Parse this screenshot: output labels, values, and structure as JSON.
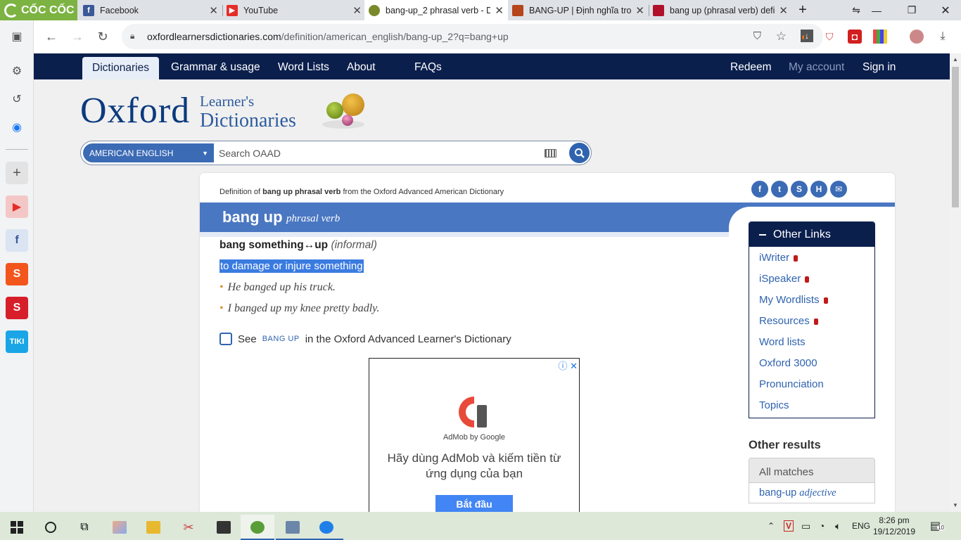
{
  "browser": {
    "brand": "CỐC CỐC",
    "tabs": [
      {
        "title": "Facebook",
        "icon": "facebook-icon",
        "color": "#3b5998"
      },
      {
        "title": "YouTube",
        "icon": "youtube-icon",
        "color": "#e52d27"
      },
      {
        "title": "bang-up_2 phrasal verb - D",
        "icon": "oxford-icon",
        "color": "#7a8a2a",
        "active": true
      },
      {
        "title": "BANG-UP | Định nghĩa tron",
        "icon": "cambridge-icon",
        "color": "#b5451b"
      },
      {
        "title": "bang up (phrasal verb) defi",
        "icon": "book-icon",
        "color": "#b0102a"
      }
    ],
    "new_tab": "+",
    "url_domain": "oxfordlearnersdictionaries.com",
    "url_path": "/definition/american_english/bang-up_2?q=bang+up"
  },
  "nav": {
    "items": [
      "Dictionaries",
      "Grammar & usage",
      "Word Lists",
      "About",
      "FAQs"
    ],
    "right": [
      "Redeem",
      "My account",
      "Sign in"
    ]
  },
  "logo": {
    "oxford": "Oxford",
    "line1": "Learner's",
    "line2": "Dictionaries"
  },
  "search": {
    "dictionary": "AMERICAN ENGLISH",
    "placeholder": "Search OAAD"
  },
  "entry": {
    "crumb_prefix": "Definition of",
    "crumb_term": "bang up phrasal verb",
    "crumb_suffix": "from the Oxford Advanced American Dictionary",
    "headword": "bang up",
    "pos": "phrasal verb",
    "idiom_main": "bang something↔up",
    "idiom_label": "(informal)",
    "definition": "to damage or injure something",
    "examples": [
      "He banged up his truck.",
      "I banged up my knee pretty badly."
    ],
    "see_prefix": "See",
    "see_term": "BANG UP",
    "see_suffix": "in the Oxford Advanced Learner's Dictionary"
  },
  "ad": {
    "brand": "AdMob by Google",
    "message": "Hãy dùng AdMob và kiếm tiền từ ứng dụng của bạn",
    "cta": "Bắt đầu"
  },
  "other_links": {
    "title": "Other Links",
    "items": [
      {
        "label": "iWriter",
        "locked": true
      },
      {
        "label": "iSpeaker",
        "locked": true
      },
      {
        "label": "My Wordlists",
        "locked": true
      },
      {
        "label": "Resources",
        "locked": true
      },
      {
        "label": "Word lists",
        "locked": false
      },
      {
        "label": "Oxford 3000",
        "locked": false
      },
      {
        "label": "Pronunciation",
        "locked": false
      },
      {
        "label": "Topics",
        "locked": false
      }
    ]
  },
  "other_results": {
    "title": "Other results",
    "all_matches": "All matches",
    "result_word": "bang-up",
    "result_pos": "adjective"
  },
  "taskbar": {
    "lang": "ENG",
    "time": "8:26 pm",
    "date": "19/12/2019",
    "notifications": "10"
  }
}
